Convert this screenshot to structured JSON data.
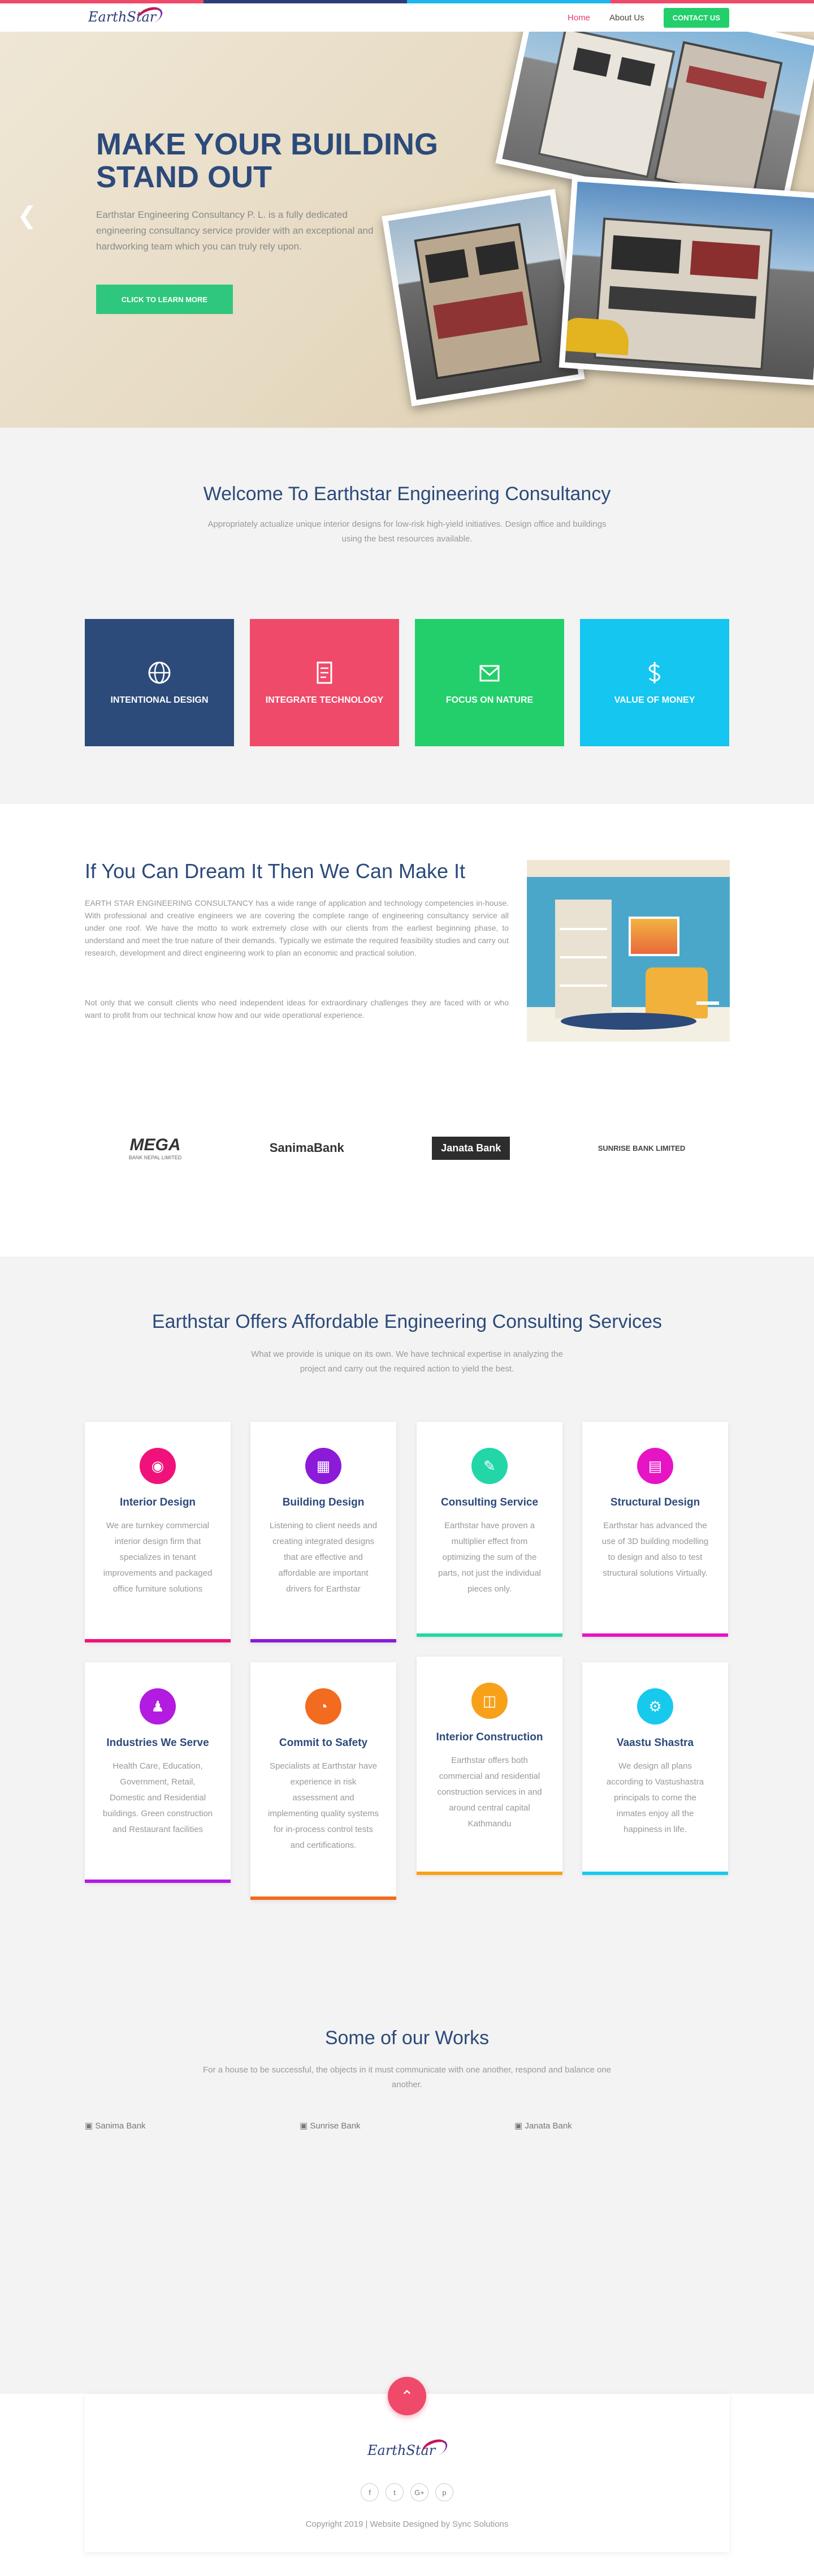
{
  "colors": {
    "brand": "#2c4a7a",
    "accent": "#e83e6c",
    "contact": "#22cf6a",
    "cta": "#2fc77d"
  },
  "top_bar_colors": [
    "#ef4a6a",
    "#2c3e7a",
    "#1fb6f0",
    "#ef4a6a"
  ],
  "header": {
    "logo_text": "EarthStar",
    "nav": [
      {
        "label": "Home",
        "active": true
      },
      {
        "label": "About Us",
        "active": false
      }
    ],
    "contact_label": "CONTACT US"
  },
  "hero": {
    "title_line1": "MAKE YOUR BUILDING",
    "title_line2": "STAND OUT",
    "description": "Earthstar Engineering Consultancy P. L. is a fully dedicated engineering consultancy service provider with an exceptional and hardworking team which you can truly rely upon.",
    "cta_label": "CLICK TO LEARN MORE",
    "prev_icon": "chevron-left-icon"
  },
  "welcome": {
    "title": "Welcome To Earthstar Engineering Consultancy",
    "subtitle": "Appropriately actualize unique interior designs for low-risk high-yield initiatives. Design office and buildings using the best resources available.",
    "features": [
      {
        "label": "INTENTIONAL DESIGN",
        "icon": "globe-icon",
        "color": "#2c4a7a"
      },
      {
        "label": "INTEGRATE TECHNOLOGY",
        "icon": "document-icon",
        "color": "#ef4a6a"
      },
      {
        "label": "FOCUS ON NATURE",
        "icon": "envelope-icon",
        "color": "#22cf6a"
      },
      {
        "label": "VALUE OF MONEY",
        "icon": "dollar-icon",
        "color": "#14c6f0"
      }
    ]
  },
  "dream": {
    "title": "If You Can Dream It Then We Can Make It",
    "paragraph1": "EARTH STAR ENGINEERING CONSULTANCY has a wide range of application and technology competencies in-house. With professional and creative engineers we are covering the complete range of engineering consultancy service all under one roof. We have the motto to work extremely close with our clients from the earliest beginning phase, to understand and meet the true nature of their demands. Typically we estimate the required feasibility studies and carry out research, development and direct engineering work to plan an economic and practical solution.",
    "paragraph2": "Not only that we consult clients who need independent ideas for extraordinary challenges they are faced with or who want to profit from our technical know how and our wide operational experience."
  },
  "clients": [
    {
      "name": "MEGA",
      "sub": "BANK NEPAL LIMITED"
    },
    {
      "name": "SanimaBank",
      "sub": ""
    },
    {
      "name": "Janata Bank",
      "sub": ""
    },
    {
      "name": "SUNRISE BANK LIMITED",
      "sub": ""
    }
  ],
  "services": {
    "title": "Earthstar Offers Affordable Engineering Consulting Services",
    "subtitle": "What we provide is unique on its own. We have technical expertise in analyzing the project and carry out the required action to yield the best.",
    "cards": [
      {
        "title": "Interior Design",
        "text": "We are turnkey commercial interior design firm that specializes in tenant improvements and packaged office furniture solutions",
        "icon": "camera-icon",
        "color": "#f0127a"
      },
      {
        "title": "Building Design",
        "text": "Listening to client needs and creating integrated designs that are effective and affordable are important drivers for Earthstar",
        "icon": "building-icon",
        "color": "#8c1bd9"
      },
      {
        "title": "Consulting Service",
        "text": "Earthstar have proven a multiplier effect from optimizing the sum of the parts, not just the individual pieces only.",
        "icon": "pen-icon",
        "color": "#22d6a7"
      },
      {
        "title": "Structural Design",
        "text": "Earthstar has advanced the use of 3D building modelling to design and also to test structural solutions Virtually.",
        "icon": "blueprint-icon",
        "color": "#e614c4"
      },
      {
        "title": "Industries We Serve",
        "text": "Health Care, Education, Government, Retail, Domestic and Residential buildings. Green construction and Restaurant facilities",
        "icon": "user-icon",
        "color": "#b31be0"
      },
      {
        "title": "Commit to Safety",
        "text": "Specialists at Earthstar have experience in risk assessment and implementing quality systems for in-process control tests and certifications.",
        "icon": "chart-icon",
        "color": "#f26b1f"
      },
      {
        "title": "Interior Construction",
        "text": "Earthstar offers both commercial and residential construction services in and around central capital Kathmandu",
        "icon": "lock-icon",
        "color": "#f7a11a"
      },
      {
        "title": "Vaastu Shastra",
        "text": "We design all plans according to Vastushastra principals to come the inmates enjoy all the happiness in life.",
        "icon": "paint-roller-icon",
        "color": "#18c9ee"
      }
    ]
  },
  "works": {
    "title": "Some of our Works",
    "subtitle": "For a house to be successful, the objects in it must communicate with one another, respond and balance one another.",
    "images": [
      "Sanima Bank",
      "Sunrise Bank",
      "Janata Bank"
    ]
  },
  "footer": {
    "logo_text": "EarthStar",
    "socials": [
      "f",
      "t",
      "G+",
      "p"
    ],
    "copyright": "Copyright 2019 | Website Designed by Sync Solutions",
    "to_top_icon": "chevron-up-icon"
  }
}
